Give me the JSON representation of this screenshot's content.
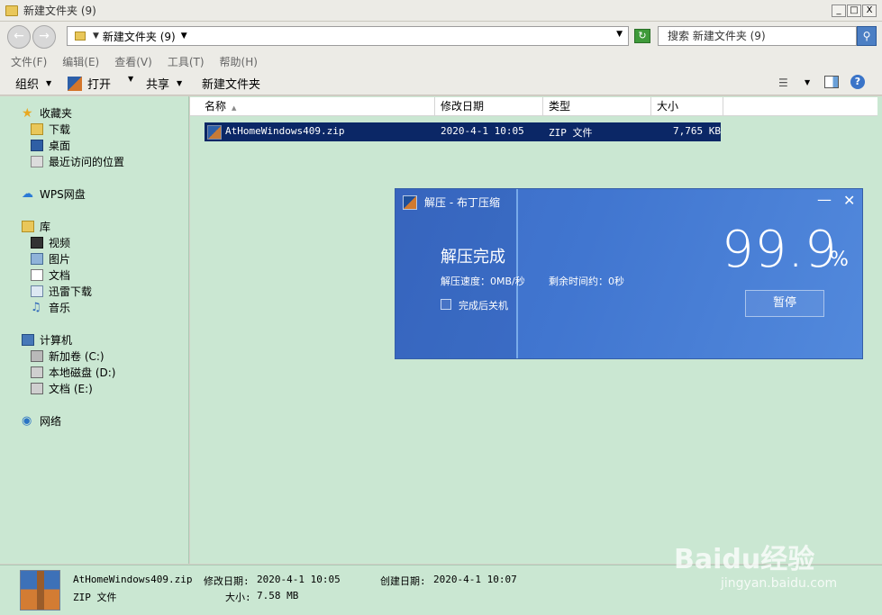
{
  "window": {
    "title": "新建文件夹 (9)",
    "min_label": "_",
    "max_label": "□",
    "close_label": "X"
  },
  "address": {
    "path": "新建文件夹 (9)",
    "search_placeholder": "搜索 新建文件夹 (9)"
  },
  "menu": [
    "文件(F)",
    "编辑(E)",
    "查看(V)",
    "工具(T)",
    "帮助(H)"
  ],
  "toolbar": {
    "organize": "组织",
    "open": "打开",
    "share": "共享",
    "new_folder": "新建文件夹"
  },
  "nav": {
    "favorites": "收藏夹",
    "downloads": "下载",
    "desktop": "桌面",
    "recent": "最近访问的位置",
    "wps": "WPS网盘",
    "libraries": "库",
    "videos": "视频",
    "pictures": "图片",
    "documents": "文档",
    "thunder": "迅雷下载",
    "music": "音乐",
    "computer": "计算机",
    "drive_c": "新加卷 (C:)",
    "drive_d": "本地磁盘 (D:)",
    "drive_e": "文档 (E:)",
    "network": "网络"
  },
  "columns": [
    "名称",
    "修改日期",
    "类型",
    "大小"
  ],
  "files": [
    {
      "name": "AtHomeWindows409.zip",
      "modified": "2020-4-1 10:05",
      "type": "ZIP 文件",
      "size": "7,765 KB"
    }
  ],
  "details": {
    "name": "AtHomeWindows409.zip",
    "modified_label": "修改日期:",
    "modified": "2020-4-1 10:05",
    "created_label": "创建日期:",
    "created": "2020-4-1 10:07",
    "type": "ZIP 文件",
    "size_label": "大小:",
    "size": "7.58 MB"
  },
  "dialog": {
    "title": "解压 - 布丁压缩",
    "status": "解压完成",
    "speed": "解压速度：0MB/秒",
    "remaining": "剩余时间约：0秒",
    "shutdown_label": "完成后关机",
    "percent_value": "99.9",
    "percent_sign": "%",
    "progress": 0.999,
    "pause_label": "暂停"
  },
  "watermark": {
    "brand": "Baidu经验",
    "url": "jingyan.baidu.com"
  }
}
